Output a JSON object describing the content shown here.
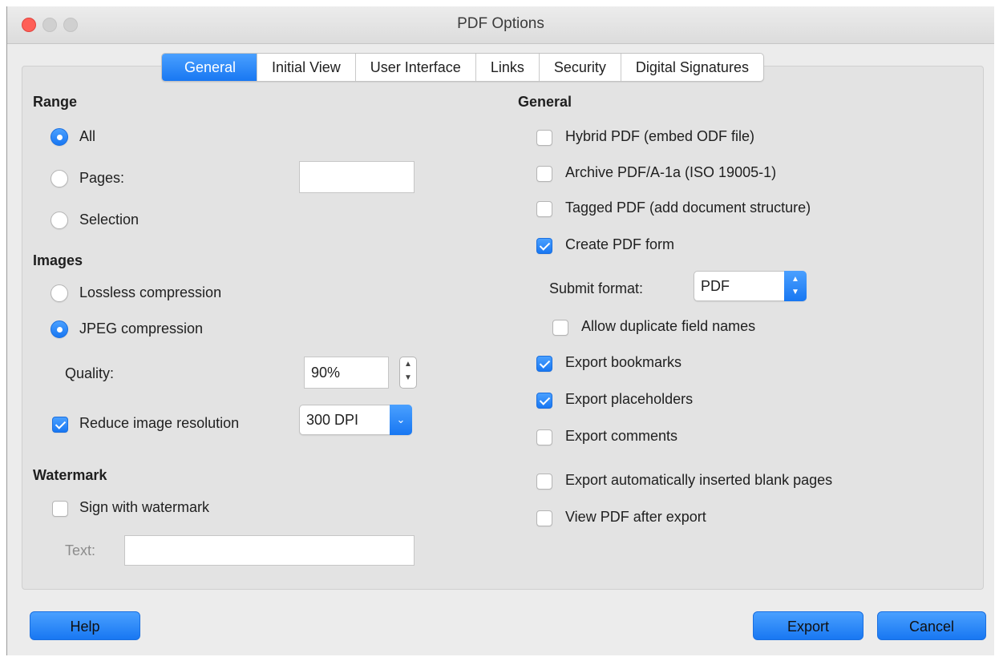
{
  "window": {
    "title": "PDF Options"
  },
  "tabs": [
    "General",
    "Initial View",
    "User Interface",
    "Links",
    "Security",
    "Digital Signatures"
  ],
  "range": {
    "heading": "Range",
    "all_label": "All",
    "pages_label": "Pages:",
    "pages_value": "",
    "selection_label": "Selection",
    "selected": "All"
  },
  "images": {
    "heading": "Images",
    "lossless_label": "Lossless compression",
    "jpeg_label": "JPEG compression",
    "selected": "JPEG compression",
    "quality_label": "Quality:",
    "quality_value": "90%",
    "reduce_label": "Reduce image resolution",
    "reduce_checked": true,
    "resolution_value": "300 DPI"
  },
  "watermark": {
    "heading": "Watermark",
    "sign_label": "Sign with watermark",
    "sign_checked": false,
    "text_label": "Text:",
    "text_value": ""
  },
  "general": {
    "heading": "General",
    "hybrid_label": "Hybrid PDF (embed ODF file)",
    "archive_label": "Archive PDF/A-1a (ISO 19005-1)",
    "tagged_label": "Tagged PDF (add document structure)",
    "form_label": "Create PDF form",
    "submit_label": "Submit format:",
    "submit_value": "PDF",
    "duplicate_label": "Allow duplicate field names",
    "bookmarks_label": "Export bookmarks",
    "placeholders_label": "Export placeholders",
    "comments_label": "Export comments",
    "blank_label": "Export automatically inserted blank pages",
    "view_label": "View PDF after export",
    "checked": {
      "hybrid": false,
      "archive": false,
      "tagged": false,
      "form": true,
      "duplicate": false,
      "bookmarks": true,
      "placeholders": true,
      "comments": false,
      "blank": false,
      "view": false
    }
  },
  "buttons": {
    "help": "Help",
    "export": "Export",
    "cancel": "Cancel"
  },
  "colors": {
    "accent": "#1877f2",
    "close": "#ff5f57"
  }
}
